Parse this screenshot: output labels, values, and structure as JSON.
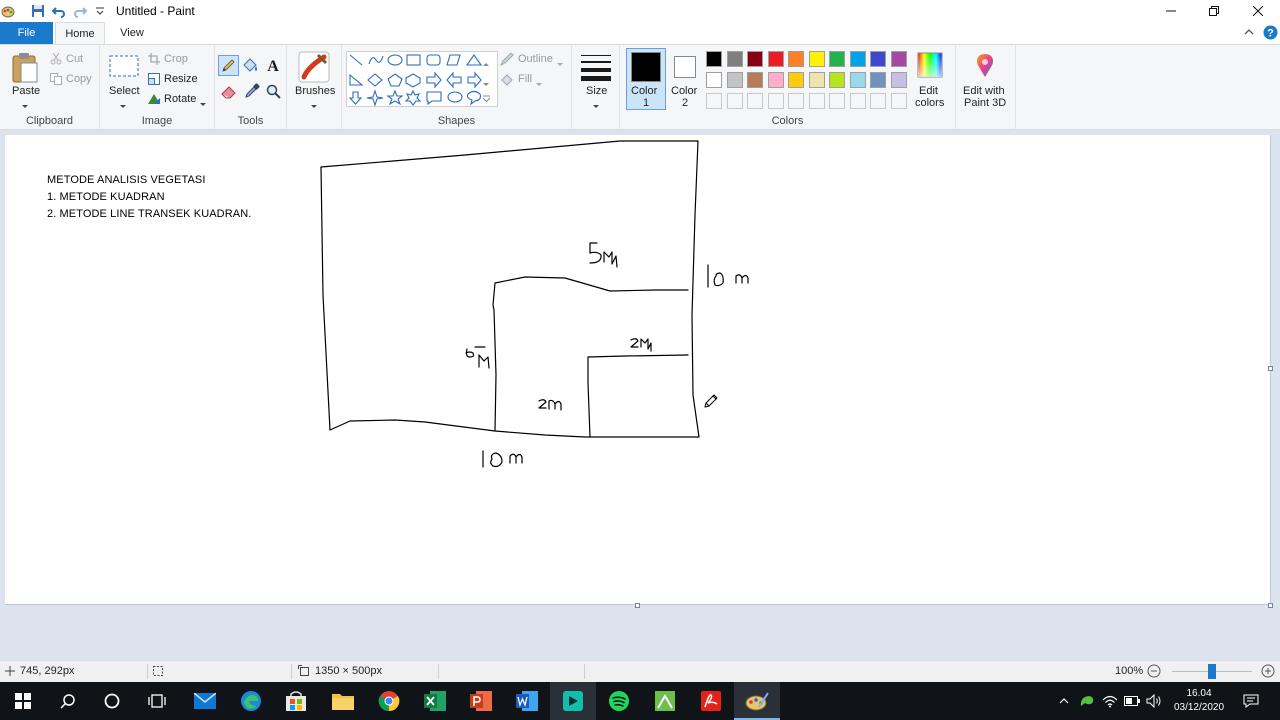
{
  "window": {
    "title": "Untitled - Paint"
  },
  "tabs": {
    "file": "File",
    "home": "Home",
    "view": "View"
  },
  "clipboard": {
    "paste": "Paste",
    "cut": "Cut",
    "copy": "Copy",
    "group": "Clipboard"
  },
  "image": {
    "select": "Select",
    "crop": "Crop",
    "resize": "Resize",
    "rotate": "Rotate",
    "group": "Image"
  },
  "tools": {
    "group": "Tools"
  },
  "brushes": {
    "label": "Brushes"
  },
  "shapes": {
    "outline": "Outline",
    "fill": "Fill",
    "group": "Shapes"
  },
  "size": {
    "label": "Size"
  },
  "colors": {
    "color1_label": "Color",
    "color1_num": "1",
    "color2_label": "Color",
    "color2_num": "2",
    "edit_line1": "Edit",
    "edit_line2": "colors",
    "group": "Colors",
    "color1": "#000000",
    "color2": "#ffffff",
    "row1": [
      "#000000",
      "#7f7f7f",
      "#880015",
      "#ed1c24",
      "#ff7f27",
      "#fff200",
      "#22b14c",
      "#00a2e8",
      "#3f48cc",
      "#a349a4"
    ],
    "row2": [
      "#ffffff",
      "#c3c3c3",
      "#b97a57",
      "#ffaec9",
      "#ffc90e",
      "#efe4b0",
      "#b5e61d",
      "#99d9ea",
      "#7092be",
      "#c8bfe7"
    ]
  },
  "paint3d": {
    "line1": "Edit with",
    "line2": "Paint 3D"
  },
  "canvas_text": {
    "line1": "METODE ANALISIS VEGETASI",
    "line2": "1. METODE KUADRAN",
    "line3": "2. METODE LINE TRANSEK KUADRAN."
  },
  "status": {
    "coords": "745, 292px",
    "dimensions": "1350 × 500px",
    "zoom": "100%"
  },
  "taskbar": {
    "time": "16.04",
    "date": "03/12/2020"
  }
}
